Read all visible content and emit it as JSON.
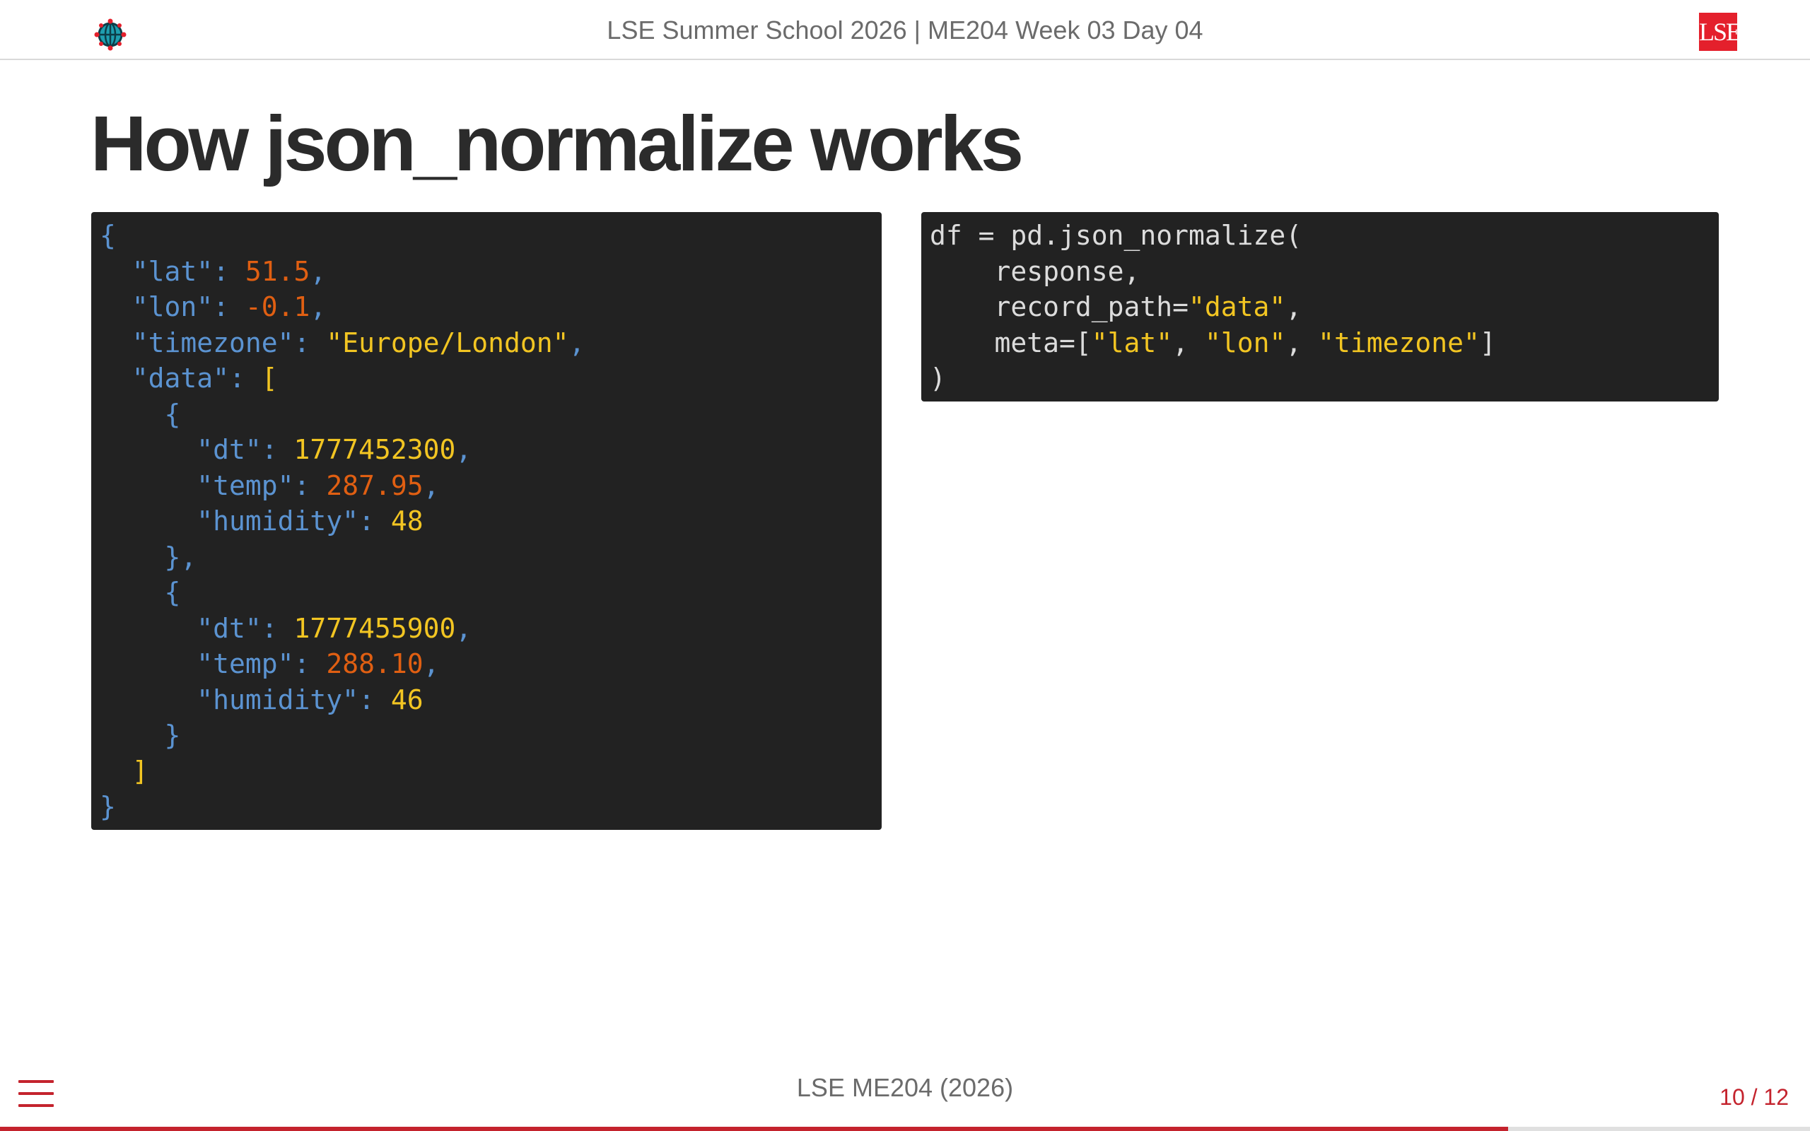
{
  "header": {
    "title": "LSE Summer School 2026 | ME204 Week 03 Day 04",
    "left_icon": "globe-icon",
    "logo_text": "LSE",
    "logo_color": "#e4202c"
  },
  "slide": {
    "title": "How json_normalize works"
  },
  "json_block": {
    "lines": [
      [
        "{"
      ],
      [
        "  \"lat\"",
        ": ",
        "51.5",
        ","
      ],
      [
        "  \"lon\"",
        ": ",
        "-0.1",
        ","
      ],
      [
        "  \"timezone\"",
        ": ",
        "\"Europe/London\"",
        ","
      ],
      [
        "  \"data\"",
        ": ",
        "["
      ],
      [
        "    {"
      ],
      [
        "      \"dt\"",
        ": ",
        "1777452300",
        ","
      ],
      [
        "      \"temp\"",
        ": ",
        "287.95",
        ","
      ],
      [
        "      \"humidity\"",
        ": ",
        "48"
      ],
      [
        "    },"
      ],
      [
        "    {"
      ],
      [
        "      \"dt\"",
        ": ",
        "1777455900",
        ","
      ],
      [
        "      \"temp\"",
        ": ",
        "288.10",
        ","
      ],
      [
        "      \"humidity\"",
        ": ",
        "46"
      ],
      [
        "    }"
      ],
      [
        "  ]"
      ],
      [
        "}"
      ]
    ]
  },
  "python_block": {
    "line1": "df = pd.json_normalize(",
    "line2": "    response,",
    "line3_a": "    record_path=",
    "line3_b": "\"data\"",
    "line3_c": ",",
    "line4_a": "    meta=[",
    "line4_b": "\"lat\"",
    "line4_c": ", ",
    "line4_d": "\"lon\"",
    "line4_e": ", ",
    "line4_f": "\"timezone\"",
    "line4_g": "]",
    "line5": ")"
  },
  "footer": {
    "text": "LSE ME204 (2026)",
    "page_number": "10 / 12",
    "menu_icon": "hamburger-menu-icon",
    "progress": 0.8333
  },
  "colors": {
    "accent": "#c4232d",
    "code_bg": "#222222",
    "code_key": "#5b93d1",
    "code_number": "#e05f12",
    "code_string": "#f2c522"
  }
}
